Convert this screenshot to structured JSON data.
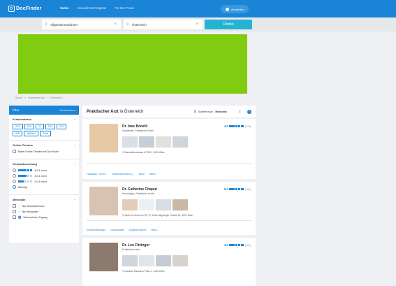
{
  "header": {
    "logo_text": "DocFinder",
    "nav": [
      "Suche",
      "Gesundheits Ratgeber",
      "Für Ihre Praxis"
    ],
    "login_label": "Anmelden"
  },
  "search": {
    "specialty_value": "Allgemeinmediziner",
    "location_value": "Österreich",
    "find_label": "Finden"
  },
  "breadcrumb": [
    "Suche",
    ">",
    "Praktischer Arzt",
    ">",
    "Österreich"
  ],
  "filter": {
    "title": "Filter",
    "reset_label": "Zurücksetzen",
    "insurance": {
      "title": "Krankenkasse",
      "chips": [
        "GKK",
        "BVA",
        "VA",
        "SVA",
        "KFA",
        "SVB",
        "Wahlarzt",
        "Privat"
      ]
    },
    "online": {
      "title": "Online-Termine",
      "option": "Bietet Online-Termine auf DocFinder"
    },
    "rating": {
      "title": "Gesamtbewertung",
      "options": [
        {
          "label": "4,5 & mehr",
          "stars": 5
        },
        {
          "label": "3,0 & mehr",
          "stars": 3
        },
        {
          "label": "2,0 & mehr",
          "stars": 2
        },
        {
          "label": "Beliebig",
          "stars": 0
        }
      ]
    },
    "features": {
      "title": "Merkmale",
      "options": [
        "Nur Behandlerinnen",
        "Nur Behandler",
        "Barrierefreier Zugang"
      ]
    }
  },
  "results": {
    "title_bold": "Praktischer Arzt",
    "title_rest": "in Österreich",
    "sort_label": "Sortiert nach",
    "sort_value": "Relevanz",
    "cards": [
      {
        "name": "Dr. Ines Bonelli",
        "specialty": "Hautärztin, Praktische Ärztin",
        "score": "4,9",
        "count": "(275)",
        "rating_stars": 5,
        "address": "Mariahilferstrasse 47/5/10, 1060 Wien",
        "tags": [
          "Hautbildu / Voror...",
          "Hautkrankheiten (...",
          "Akne",
          "Mehr..."
        ],
        "photo_color": "#e8c9a6",
        "thumb_colors": [
          "#d9dfe6",
          "#c7ced6",
          "#e3e0dc",
          "#cfd5db"
        ]
      },
      {
        "name": "Dr. Catherine Chaput",
        "specialty": "Neurologin, Praktische Ärztin",
        "score": "5,0",
        "count": "(150)",
        "rating_stars": 5,
        "address": "Stoß im Himmel 1/Tür 17, Ecke Wipplinger Straße 33, 1010 Wien",
        "tags": [
          "Schmerztherapie",
          "Osteopathie",
          "Kopfschmerzen",
          "Mehr..."
        ],
        "photo_color": "#d8c3b3",
        "thumb_colors": [
          "#e3cdb8",
          "#e9f1f4",
          "#d7dde2",
          "#c9b8a4"
        ]
      },
      {
        "name": "Dr. Leo Fitzinger",
        "specialty": "Praktischer Arzt",
        "score": "4,9",
        "count": "(221)",
        "rating_stars": 5,
        "address": "Kardinal Rauscher Platz 4, 1150 Wien",
        "tags": [],
        "photo_color": "#8d7a6e",
        "thumb_colors": [
          "#cfd6dc",
          "#dfe5ea",
          "#c5ccd3",
          "#d7d2cc"
        ]
      }
    ]
  }
}
